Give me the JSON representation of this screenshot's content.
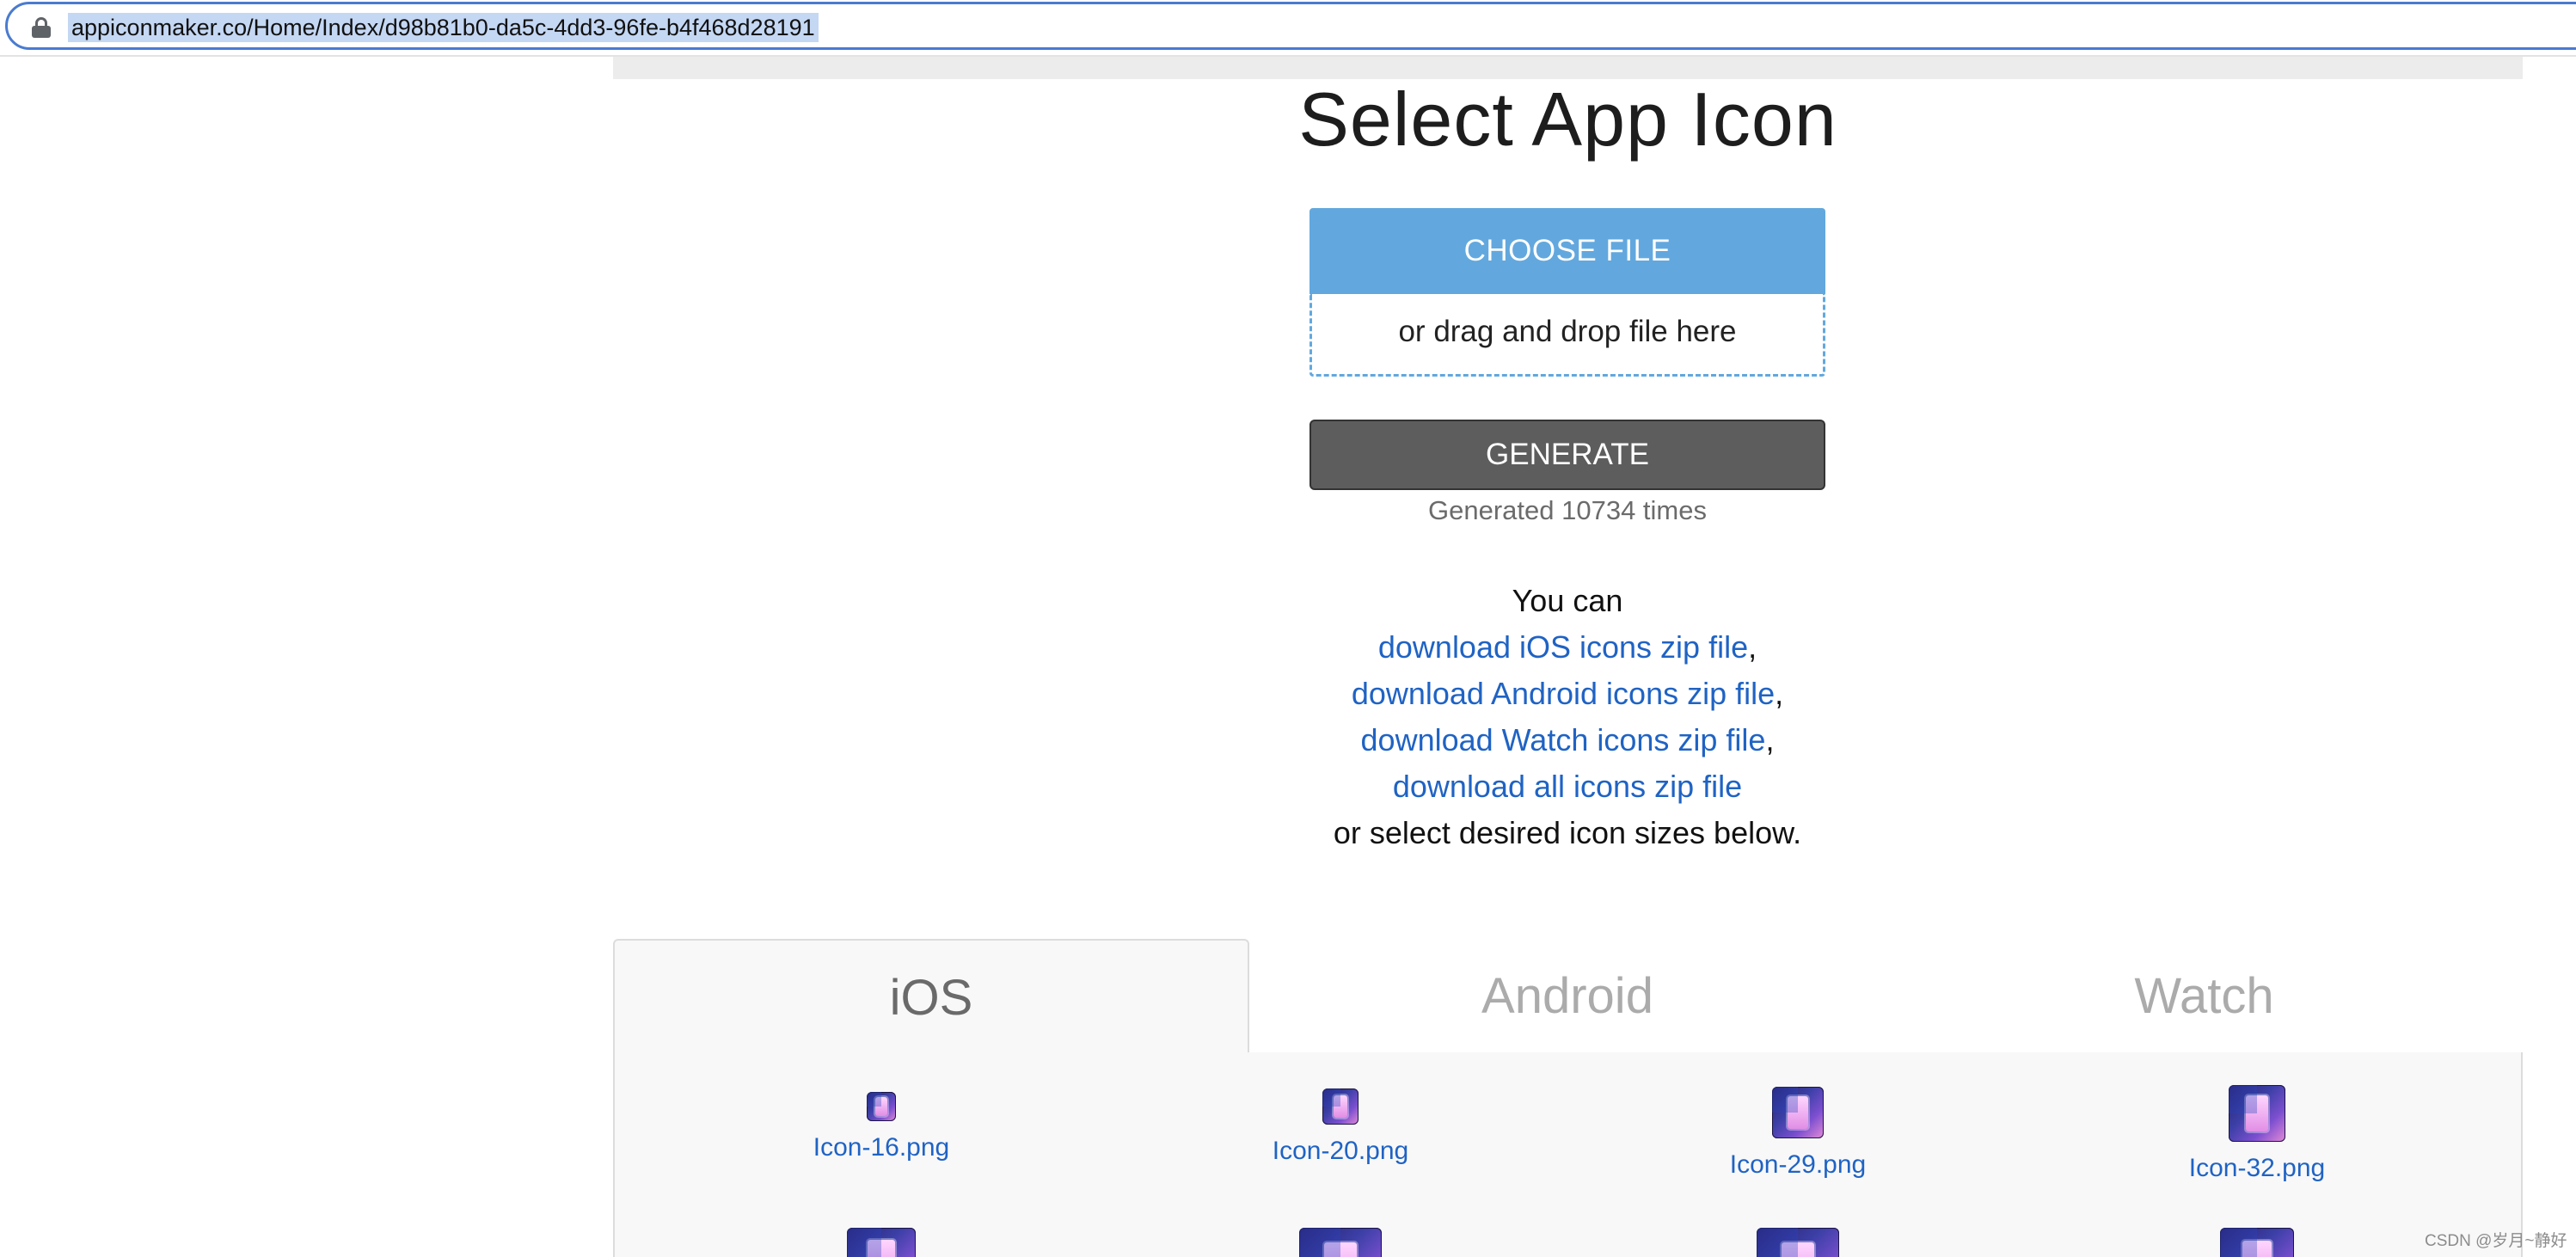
{
  "browser": {
    "url": "appiconmaker.co/Home/Index/d98b81b0-da5c-4dd3-96fe-b4f468d28191"
  },
  "page": {
    "title": "Select App Icon",
    "choose_file_label": "CHOOSE FILE",
    "drop_hint": "or drag and drop file here",
    "generate_label": "GENERATE",
    "generated_count": "Generated 10734 times",
    "you_can": "You can",
    "links": {
      "ios": "download iOS icons zip file",
      "android": "download Android icons zip file",
      "watch": "download Watch icons zip file",
      "all": "download all icons zip file"
    },
    "select_below": "or select desired icon sizes below."
  },
  "tabs": [
    {
      "label": "iOS",
      "active": true
    },
    {
      "label": "Android",
      "active": false
    },
    {
      "label": "Watch",
      "active": false
    }
  ],
  "icons": [
    {
      "label": "Icon-16.png"
    },
    {
      "label": "Icon-20.png"
    },
    {
      "label": "Icon-29.png"
    },
    {
      "label": "Icon-32.png"
    }
  ],
  "watermark": "CSDN @岁月~静好",
  "colors": {
    "accent_blue": "#62a8de",
    "link_blue": "#1f63c4",
    "generate_gray": "#5d5d5d"
  }
}
